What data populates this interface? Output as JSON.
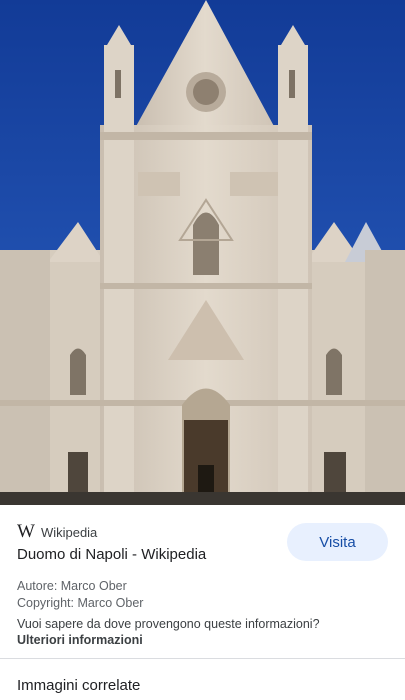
{
  "image": {
    "alt": "Duomo di Napoli",
    "sky_color": "#1f4fb0",
    "stone_color": "#d9cfc2"
  },
  "source": {
    "logo": "W",
    "name": "Wikipedia"
  },
  "visit_button": {
    "label": "Visita"
  },
  "page_title": "Duomo di Napoli - Wikipedia",
  "author": "Autore: Marco Ober",
  "copyright": "Copyright: Marco Ober",
  "question": "Vuoi sapere da dove provengono queste informazioni?",
  "more_info": "Ulteriori informazioni",
  "related_heading": "Immagini correlate"
}
